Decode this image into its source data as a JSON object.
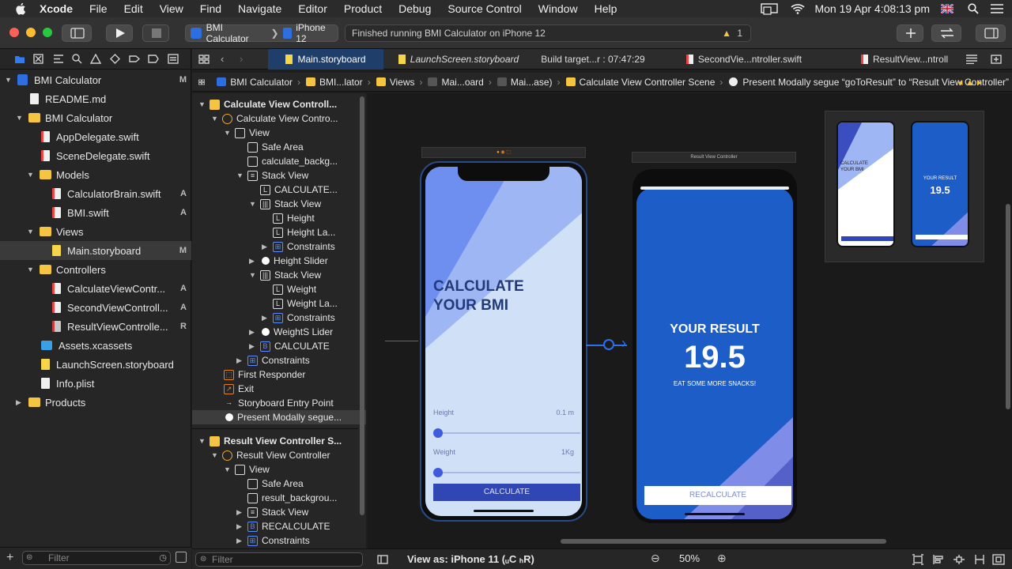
{
  "menubar": {
    "items": [
      "Xcode",
      "File",
      "Edit",
      "View",
      "Find",
      "Navigate",
      "Editor",
      "Product",
      "Debug",
      "Source Control",
      "Window",
      "Help"
    ],
    "clock": "Mon 19 Apr  4:08:13 pm"
  },
  "toolbar": {
    "scheme": "BMI Calculator",
    "device": "iPhone 12",
    "status": "Finished running BMI Calculator on iPhone 12",
    "warning_count": "1"
  },
  "navigator": {
    "rows": [
      {
        "label": "BMI Calculator",
        "badge": "M"
      },
      {
        "label": "README.md",
        "badge": ""
      },
      {
        "label": "BMI Calculator",
        "badge": ""
      },
      {
        "label": "AppDelegate.swift",
        "badge": ""
      },
      {
        "label": "SceneDelegate.swift",
        "badge": ""
      },
      {
        "label": "Models",
        "badge": ""
      },
      {
        "label": "CalculatorBrain.swift",
        "badge": "A"
      },
      {
        "label": "BMI.swift",
        "badge": "A"
      },
      {
        "label": "Views",
        "badge": ""
      },
      {
        "label": "Main.storyboard",
        "badge": "M"
      },
      {
        "label": "Controllers",
        "badge": ""
      },
      {
        "label": "CalculateViewContr...",
        "badge": "A"
      },
      {
        "label": "SecondViewControll...",
        "badge": "A"
      },
      {
        "label": "ResultViewControlle...",
        "badge": "R"
      },
      {
        "label": "Assets.xcassets",
        "badge": ""
      },
      {
        "label": "LaunchScreen.storyboard",
        "badge": ""
      },
      {
        "label": "Info.plist",
        "badge": ""
      },
      {
        "label": "Products",
        "badge": ""
      }
    ],
    "filter_placeholder": "Filter"
  },
  "tabs": [
    "Main.storyboard",
    "LaunchScreen.storyboard",
    "Build target...r : 07:47:29",
    "SecondVie...ntroller.swift",
    "ResultView...ntroll"
  ],
  "jumpbar": [
    "BMI Calculator",
    "BMI...lator",
    "Views",
    "Mai...oard",
    "Mai...ase)",
    "Calculate View Controller Scene",
    "Present Modally segue “goToResult” to “Result View Controller”"
  ],
  "outline": {
    "rows": [
      "Calculate View Controll...",
      "Calculate View Contro...",
      "View",
      "Safe Area",
      "calculate_backg...",
      "Stack View",
      "CALCULATE...",
      "Stack View",
      "Height",
      "Height La...",
      "Constraints",
      "Height Slider",
      "Stack View",
      "Weight",
      "Weight La...",
      "Constraints",
      "WeightS Lider",
      "CALCULATE",
      "Constraints",
      "First Responder",
      "Exit",
      "Storyboard Entry Point",
      "Present Modally segue...",
      "Result View Controller S...",
      "Result View Controller",
      "View",
      "Safe Area",
      "result_backgrou...",
      "Stack View",
      "RECALCULATE",
      "Constraints"
    ],
    "filter_placeholder": "Filter"
  },
  "calculate_screen": {
    "title_line1": "CALCULATE",
    "title_line2": "YOUR BMI",
    "height_label": "Height",
    "height_value": "0.1 m",
    "weight_label": "Weight",
    "weight_value": "1Kg",
    "button": "CALCULATE"
  },
  "result_screen": {
    "header": "Result View Controller",
    "title": "YOUR RESULT",
    "value": "19.5",
    "advice": "EAT SOME MORE SNACKS!",
    "button": "RECALCULATE"
  },
  "minimap": {
    "calc_title": "CALCULATE\nYOUR BMI",
    "result_title": "YOUR RESULT",
    "result_value": "19.5"
  },
  "bottombar": {
    "view_as": "View as: iPhone 11 (ᵤC ₕR)",
    "zoom": "50%"
  },
  "colors": {
    "accent": "#1f3f6a",
    "folder": "#f5c542",
    "result_blue": "#1d5dc8",
    "calc_light": "#cfe0f7"
  }
}
